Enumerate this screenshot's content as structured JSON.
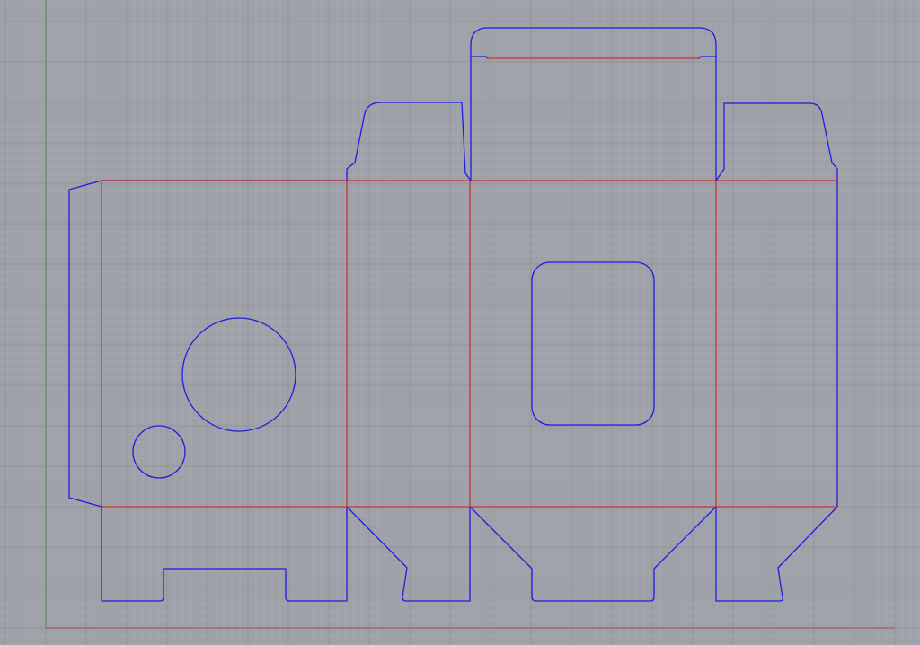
{
  "viewport": {
    "background": "#9ea1a7",
    "grid_minor_color": "#a9acb1",
    "grid_major_color": "#8f9298",
    "axis_y_color": "#5f8a63",
    "axis_x_color": "#a05f5f"
  },
  "dieline": {
    "cut_color": "#1d1de0",
    "fold_color": "#d01818"
  }
}
